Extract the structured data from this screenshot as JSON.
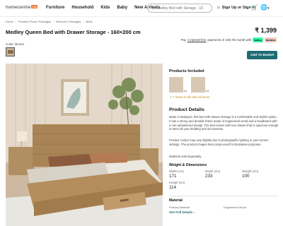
{
  "header": {
    "logo_text": "homecentre",
    "logo_badge": "hub",
    "nav": [
      "Furniture",
      "Household",
      "Kids",
      "Baby",
      "New Arrivals"
    ],
    "search_placeholder": "Medley Bed with Storage - 16",
    "signin": "Sign Up or Sign In"
  },
  "breadcrumb": [
    "Home",
    "Furniture Room Packages",
    "Bedroom Packages",
    "Beds"
  ],
  "product": {
    "title": "Medley Queen Bed with Drawer Storage - 160×200 cm",
    "price_currency": "₹",
    "price": "1,399",
    "installment_pre": "Pay",
    "installment_link": "4 interest-free",
    "installment_post": "payments of",
    "installment_amount": "349.75/ month with",
    "tabby": "tabby",
    "tamara": "tamara",
    "color_label": "Color:",
    "color_value": "Brown",
    "add_to_basket": "Add To Basket"
  },
  "included": {
    "heading": "Products Included",
    "items": [
      {
        "count": "x1"
      },
      {
        "count": "x1"
      }
    ],
    "stock_note": "7 Views in the last 24 hours"
  },
  "details": {
    "heading": "Product Details",
    "para1": "Made in Malaysia, this bed with drawer storage is a comfortable and stylish option. It has a strong and durable frame made of engineered wood and a headboard with a non-upholstered design. The bed comes with one drawer that is spacious enough to store all your bedding and accessories.",
    "para2": "Product Colour may vary slightly due to photographic lighting or your screen settings. The product images here props used for illustrative purposes.",
    "para3": "Mattress sold separately."
  },
  "dimensions": {
    "heading": "Weight & Dimensions",
    "width_label": "Width (cm)",
    "width": "171",
    "depth_label": "Depth (cm)",
    "depth": "233",
    "weight_label": "Weight (cm)",
    "weight": "100",
    "height_label": "Height (cm)",
    "height": "114"
  },
  "material": {
    "heading": "Material",
    "label1": "Primary Material",
    "label2": "Engineered Wood",
    "see_full": "See Full Details"
  },
  "colors": {
    "accent": "#1f6b74",
    "stock": "#c8861c",
    "tabby": "#3bffb0"
  }
}
